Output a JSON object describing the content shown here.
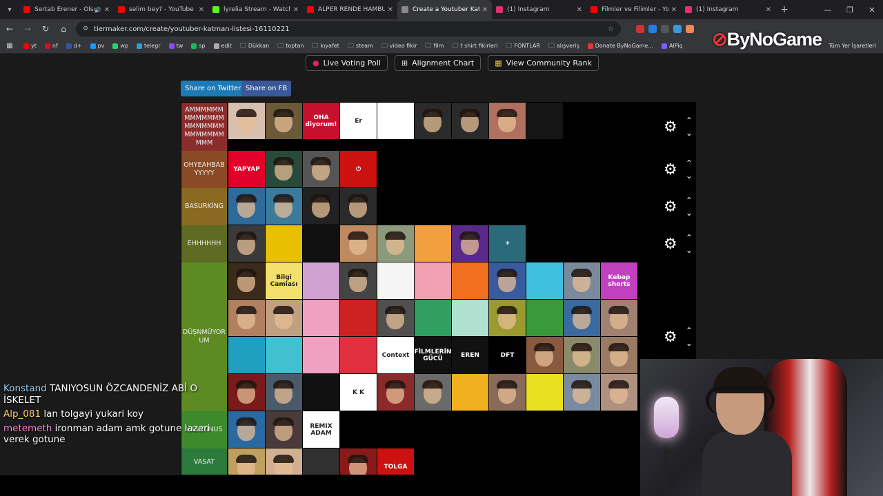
{
  "browser": {
    "tabs": [
      {
        "title": "Sertab Erener - Olsun",
        "color": "#ff0000",
        "audio": true
      },
      {
        "title": "selim bey? - YouTube",
        "color": "#ff0000"
      },
      {
        "title": "lyrelia Stream - Watch Liv",
        "color": "#53fc18"
      },
      {
        "title": "ALPER RENDE HAMBURG",
        "color": "#ff0000"
      },
      {
        "title": "Create a Youtuber Katman",
        "color": "#8a8a8a",
        "active": true
      },
      {
        "title": "(1) Instagram",
        "color": "#e1306c"
      },
      {
        "title": "Filmler ve Filimler - YouTu",
        "color": "#ff0000"
      },
      {
        "title": "(1) Instagram",
        "color": "#e1306c"
      }
    ],
    "url": "tiermaker.com/create/youtuber-katman-listesi-16110221",
    "bookmarks": [
      {
        "label": "yt",
        "color": "#ff0000"
      },
      {
        "label": "nf",
        "color": "#e50914"
      },
      {
        "label": "d+",
        "color": "#2c5aa0"
      },
      {
        "label": "pv",
        "color": "#1399ff"
      },
      {
        "label": "wp",
        "color": "#25d366"
      },
      {
        "label": "telegr",
        "color": "#2aa1da"
      },
      {
        "label": "tw",
        "color": "#9146ff"
      },
      {
        "label": "sp",
        "color": "#1db954"
      },
      {
        "label": "edit",
        "color": "#aaaaaa"
      },
      {
        "label": "Dükkan",
        "folder": true
      },
      {
        "label": "toptan",
        "folder": true
      },
      {
        "label": "kıyafet",
        "folder": true
      },
      {
        "label": "steam",
        "folder": true
      },
      {
        "label": "video fikir",
        "folder": true
      },
      {
        "label": "film",
        "folder": true
      },
      {
        "label": "t shirt fikirleri",
        "folder": true
      },
      {
        "label": "FONTLAR",
        "folder": true
      },
      {
        "label": "alışveriş",
        "folder": true
      },
      {
        "label": "Donate ByNoGame...",
        "color": "#e53935"
      },
      {
        "label": "AIPiq",
        "color": "#7b61ff"
      }
    ],
    "all_bookmarks": "Tüm Yer İşaretleri"
  },
  "overlay_logo": "ByNoGame",
  "page": {
    "buttons": {
      "live_poll": "Live Voting Poll",
      "alignment": "Alignment Chart",
      "community": "View Community Rank"
    },
    "share_twitter": "Share on Twitter",
    "share_fb": "Share on FB",
    "tiers": [
      {
        "label": "AMMMMMMMMMMMMMMMMMMMMMMMMMMMMMM",
        "color": "#8b2d2d",
        "items": [
          {
            "c": "#d8c0b0"
          },
          {
            "c": "#6b5a3a"
          },
          {
            "c": "#c8102e",
            "t": "OHA diyorum!"
          },
          {
            "c": "#ffffff",
            "t": "Er"
          },
          {
            "c": "#ffffff",
            "t": ""
          },
          {
            "c": "#2b2b2b"
          },
          {
            "c": "#2a2a2a"
          },
          {
            "c": "#b07060"
          },
          {
            "c": "#151515",
            "t": ""
          }
        ]
      },
      {
        "label": "OHYEAHBABYYYYY",
        "color": "#8a4a25",
        "items": [
          {
            "c": "#e0002a",
            "t": "YAPYAP"
          },
          {
            "c": "#274a3a"
          },
          {
            "c": "#555555"
          },
          {
            "c": "#cc1111",
            "t": "⏻"
          }
        ]
      },
      {
        "label": "BASURKİNG",
        "color": "#8a6a22",
        "items": [
          {
            "c": "#2e6a9a"
          },
          {
            "c": "#3a7a9a"
          },
          {
            "c": "#222222"
          },
          {
            "c": "#2a2a2a"
          }
        ]
      },
      {
        "label": "EHHHHHH",
        "color": "#5f6b22",
        "items": [
          {
            "c": "#3a3a3a"
          },
          {
            "c": "#e8c000",
            "t": ""
          },
          {
            "c": "#111111",
            "t": ""
          },
          {
            "c": "#c08a60"
          },
          {
            "c": "#8a9a7a"
          },
          {
            "c": "#f0a040",
            "t": ""
          },
          {
            "c": "#5a2a8a"
          },
          {
            "c": "#2a6a7a",
            "t": "☀"
          }
        ]
      },
      {
        "label": "DÜŞNMÜYORUM",
        "color": "#5d8a23",
        "items": [
          {
            "c": "#3a2a1a"
          },
          {
            "c": "#f2e06a",
            "t": "Bilgi Camiası"
          },
          {
            "c": "#d0a0d0",
            "t": ""
          },
          {
            "c": "#444444"
          },
          {
            "c": "#f5f5f5",
            "t": ""
          },
          {
            "c": "#f0a0b0",
            "t": ""
          },
          {
            "c": "#f07020",
            "t": ""
          },
          {
            "c": "#3a5aa0"
          },
          {
            "c": "#40c0e0",
            "t": ""
          },
          {
            "c": "#7a8a9a"
          },
          {
            "c": "#c040c0",
            "t": "Kebap shorts"
          },
          {
            "c": "#b08060"
          },
          {
            "c": "#c0a080"
          },
          {
            "c": "#f0a0c0",
            "t": ""
          },
          {
            "c": "#cc2222",
            "t": ""
          },
          {
            "c": "#505050"
          },
          {
            "c": "#30a060",
            "t": ""
          },
          {
            "c": "#b0e0d0",
            "t": ""
          },
          {
            "c": "#9a9a30"
          },
          {
            "c": "#3a9a3a",
            "t": ""
          },
          {
            "c": "#3a6aa0"
          },
          {
            "c": "#a08070"
          },
          {
            "c": "#20a0c0",
            "t": ""
          },
          {
            "c": "#40c0d0",
            "t": ""
          },
          {
            "c": "#f0a0c0",
            "t": ""
          },
          {
            "c": "#e03040",
            "t": ""
          },
          {
            "c": "#ffffff",
            "t": "Context"
          },
          {
            "c": "#111111",
            "t": "FİLMLERİN GÜCÜ"
          },
          {
            "c": "#111111",
            "t": "EREN"
          },
          {
            "c": "#000000",
            "t": "DFT"
          },
          {
            "c": "#8a5a40"
          },
          {
            "c": "#8a8a6a"
          },
          {
            "c": "#9a7a60"
          },
          {
            "c": "#7a1a1a"
          },
          {
            "c": "#4a5a6a"
          },
          {
            "c": "#111111",
            "t": ""
          },
          {
            "c": "#ffffff",
            "t": "K K"
          },
          {
            "c": "#8a2a2a"
          },
          {
            "c": "#6a6a6a"
          },
          {
            "c": "#f0b020",
            "t": ""
          },
          {
            "c": "#8a6a5a"
          },
          {
            "c": "#e8e020",
            "t": ""
          },
          {
            "c": "#7a8aa0"
          },
          {
            "c": "#b09080"
          }
        ]
      },
      {
        "label": "VASATINUS",
        "color": "#3c8a2c",
        "items": [
          {
            "c": "#2a6aa0"
          },
          {
            "c": "#4a3a3a"
          },
          {
            "c": "#ffffff",
            "t": "REMIX ADAM"
          }
        ]
      },
      {
        "label": "VASAT",
        "color": "#2c7a3c",
        "items": [
          {
            "c": "#c0a060"
          },
          {
            "c": "#d0b090"
          },
          {
            "c": "#303030",
            "t": ""
          },
          {
            "c": "#8a1a1a"
          },
          {
            "c": "#cc1111",
            "t": "TOLGA"
          }
        ]
      }
    ]
  },
  "chat": [
    {
      "user": "Konstand",
      "text": "TANIYOSUN ÖZCANDENİZ ABİ O İSKELET"
    },
    {
      "user": "Alp_081",
      "text": "lan tolgayi yukari koy"
    },
    {
      "user": "metemeth",
      "text": "ironman adam amk gotune lazeri verek gotune"
    }
  ]
}
